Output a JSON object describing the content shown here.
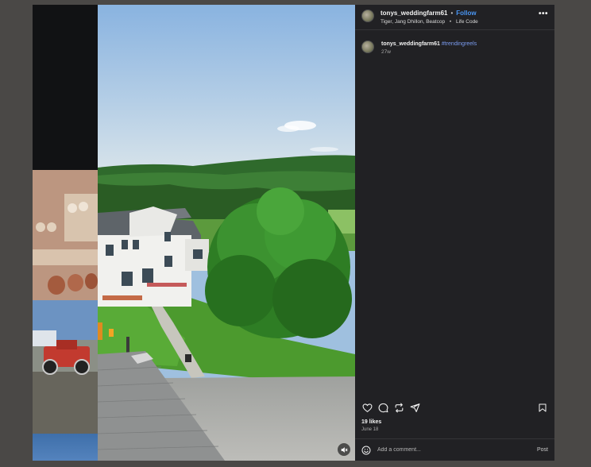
{
  "post": {
    "username": "tonys_weddingfarm61",
    "separator": "•",
    "follow_label": "Follow",
    "audio": "Tiger, Jang Dhillon, Beatcop",
    "audio_separator": "•",
    "audio_title": "Life Code",
    "more_label": "•••"
  },
  "caption": {
    "username": "tonys_weddingfarm61",
    "hashtag": "#trendingreels",
    "time_ago": "27w"
  },
  "engagement": {
    "likes": "19 likes",
    "date": "June 18"
  },
  "comment_box": {
    "placeholder": "Add a comment...",
    "post_label": "Post"
  },
  "icons": {
    "like": "heart-icon",
    "comment": "comment-icon",
    "repost": "repost-icon",
    "share": "send-icon",
    "save": "bookmark-icon",
    "emoji": "emoji-icon",
    "mute": "speaker-muted-icon",
    "more": "more-options-icon"
  },
  "colors": {
    "panel_bg": "#212124",
    "follow": "#4a97f5",
    "hashtag": "#7b9cf0",
    "backdrop": "#4a4846"
  }
}
